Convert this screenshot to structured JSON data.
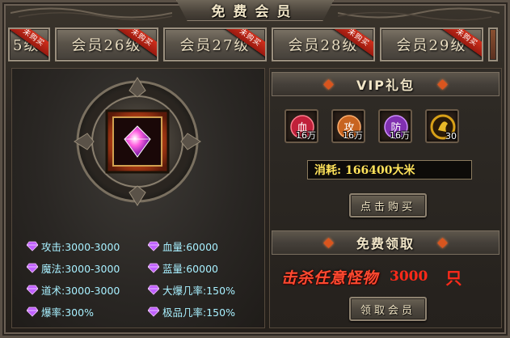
{
  "window": {
    "title": "免费会员"
  },
  "tabs": [
    {
      "label": "5级",
      "badge": "未购买"
    },
    {
      "label": "会员26级",
      "badge": "未购买"
    },
    {
      "label": "会员27级",
      "badge": "未购买"
    },
    {
      "label": "会员28级",
      "badge": "未购买"
    },
    {
      "label": "会员29级",
      "badge": "未购买"
    }
  ],
  "stats": [
    {
      "text": "攻击:3000-3000"
    },
    {
      "text": "血量:60000"
    },
    {
      "text": "魔法:3000-3000"
    },
    {
      "text": "蓝量:60000"
    },
    {
      "text": "道术:3000-3000"
    },
    {
      "text": "大爆几率:150%"
    },
    {
      "text": "爆率:300%"
    },
    {
      "text": "极品几率:150%"
    }
  ],
  "vip": {
    "title": "VIP礼包",
    "items": [
      {
        "icon": "blood-potion-icon",
        "glyph": "血",
        "qty": "16万",
        "color": "#c0203a"
      },
      {
        "icon": "attack-potion-icon",
        "glyph": "攻",
        "qty": "16万",
        "color": "#c86420"
      },
      {
        "icon": "defense-potion-icon",
        "glyph": "防",
        "qty": "16万",
        "color": "#8030b0"
      },
      {
        "icon": "gold-shield-icon",
        "glyph": "",
        "qty": "30",
        "color": "#d8a018"
      }
    ],
    "cost": "消耗: 166400大米",
    "buy_label": "点击购买"
  },
  "free": {
    "title": "免费领取",
    "kill_label": "击杀任意怪物",
    "kill_count": "3000",
    "kill_unit": "只",
    "claim_label": "领取会员"
  }
}
